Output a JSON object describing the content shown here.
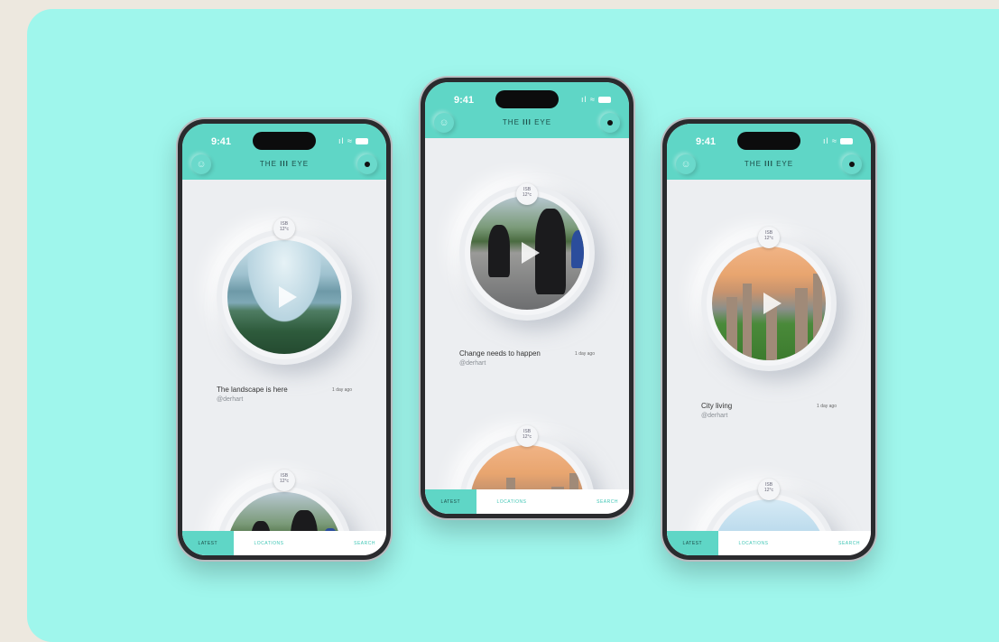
{
  "app": {
    "brand_prefix": "THE",
    "brand_mark": "III",
    "brand_suffix": "EYE",
    "status_time": "9:41",
    "status_icons": "ıl ≈",
    "accent": "#5fd6c6"
  },
  "tabs": [
    "LATEST",
    "LOCATIONS",
    "SEARCH"
  ],
  "icons": {
    "avatar": "person-icon",
    "record": "record-dot-icon",
    "play": "play-icon"
  },
  "phones": [
    {
      "post": {
        "caption": "The landscape is here",
        "handle": "@derhart",
        "ago": "1 day ago",
        "temp_top": "ISB",
        "temp_value": "12°c",
        "media": "landscape"
      },
      "next": {
        "temp_top": "ISB",
        "temp_value": "12°c",
        "media": "skateboarders"
      }
    },
    {
      "post": {
        "caption": "Change needs to happen",
        "handle": "@derhart",
        "ago": "1 day ago",
        "temp_top": "ISB",
        "temp_value": "12°c",
        "media": "skateboarders"
      },
      "next": {
        "temp_top": "ISB",
        "temp_value": "12°c",
        "media": "city"
      }
    },
    {
      "post": {
        "caption": "City living",
        "handle": "@derhart",
        "ago": "1 day ago",
        "temp_top": "ISB",
        "temp_value": "12°c",
        "media": "city"
      },
      "next": {
        "temp_top": "ISB",
        "temp_value": "12°c",
        "media": "sky-tower"
      }
    }
  ]
}
